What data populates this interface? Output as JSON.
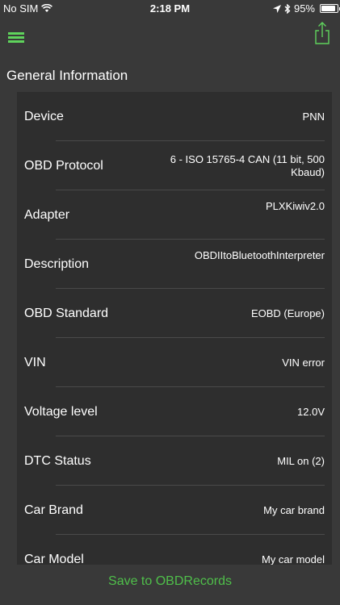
{
  "status_bar": {
    "carrier": "No SIM",
    "time": "2:18 PM",
    "battery": "95%",
    "battery_level": 0.95
  },
  "nav": {
    "menu_icon": "hamburger-menu-icon",
    "share_icon": "share-icon",
    "accent_color": "#5fd35c"
  },
  "section": {
    "title": "General Information"
  },
  "info_rows": [
    {
      "label": "Device",
      "value": "PNN"
    },
    {
      "label": "OBD Protocol",
      "value": "6 - ISO 15765-4 CAN (11 bit, 500 Kbaud)"
    },
    {
      "label": "Adapter",
      "value": "PLXKiwiv2.0"
    },
    {
      "label": "Description",
      "value": "OBDIItoBluetoothInterpreter"
    },
    {
      "label": "OBD Standard",
      "value": "EOBD (Europe)"
    },
    {
      "label": "VIN",
      "value": "VIN error"
    },
    {
      "label": "Voltage level",
      "value": "12.0V"
    },
    {
      "label": "DTC Status",
      "value": "MIL on (2)"
    },
    {
      "label": "Car Brand",
      "value": "My car brand"
    },
    {
      "label": "Car Model",
      "value": "My car model"
    }
  ],
  "footer": {
    "save_label": "Save to OBDRecords"
  }
}
